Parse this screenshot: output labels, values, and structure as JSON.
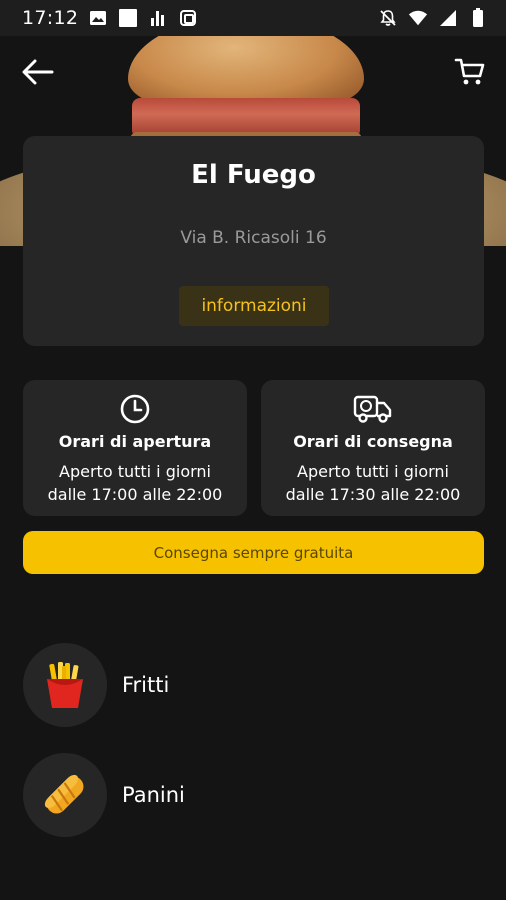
{
  "status_bar": {
    "time": "17:12",
    "left_icons": [
      "image-icon",
      "square-icon",
      "signal-bars-icon",
      "screen-record-icon"
    ],
    "right_icons": [
      "notifications-off-icon",
      "wifi-icon",
      "cell-signal-icon",
      "battery-icon"
    ]
  },
  "header": {
    "back_icon": "arrow-left-icon",
    "cart_icon": "cart-icon"
  },
  "restaurant": {
    "name": "El Fuego",
    "address": "Via B. Ricasoli 16",
    "info_label": "informazioni"
  },
  "hours": {
    "opening": {
      "icon": "clock-icon",
      "title": "Orari di apertura",
      "line1": "Aperto tutti i giorni",
      "line2": "dalle 17:00 alle 22:00"
    },
    "delivery": {
      "icon": "delivery-truck-icon",
      "title": "Orari di consegna",
      "line1": "Aperto tutti i giorni",
      "line2": "dalle 17:30 alle 22:00"
    }
  },
  "delivery_banner": "Consegna sempre gratuita",
  "categories": [
    {
      "label": "Fritti",
      "icon": "fries-icon"
    },
    {
      "label": "Panini",
      "icon": "bread-icon"
    }
  ],
  "colors": {
    "background": "#141414",
    "card": "#262626",
    "accent": "#f6c200",
    "accent_text": "#f4c21b"
  }
}
